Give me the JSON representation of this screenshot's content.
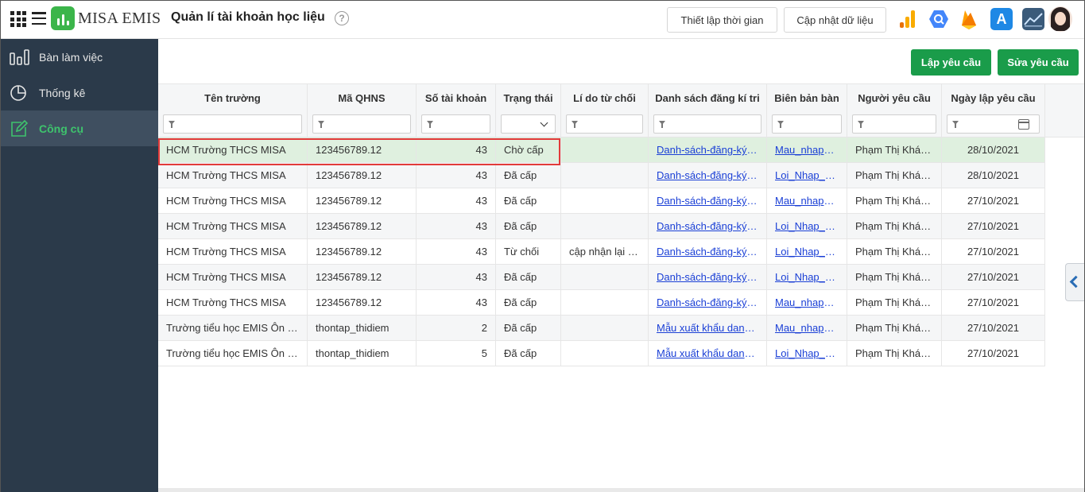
{
  "app": {
    "logo_text": "MISA EMIS",
    "page_title": "Quản lí tài khoản học liệu",
    "help_label": "?"
  },
  "toolbar": {
    "time_setup_label": "Thiết lập thời gian",
    "update_data_label": "Cập nhật dữ liệu",
    "store_icon_glyph": "A"
  },
  "sidebar": {
    "items": [
      {
        "label": "Bàn làm việc",
        "icon": "dashboard-icon",
        "active": false
      },
      {
        "label": "Thống kê",
        "icon": "pie-chart-icon",
        "active": false
      },
      {
        "label": "Công cụ",
        "icon": "edit-tool-icon",
        "active": true
      }
    ]
  },
  "actions": {
    "create_label": "Lập yêu cầu",
    "edit_label": "Sửa yêu cầu"
  },
  "table": {
    "columns": [
      "Tên trường",
      "Mã QHNS",
      "Số tài khoản",
      "Trạng thái",
      "Lí do từ chối",
      "Danh sách đăng kí tri",
      "Biên bản bàn",
      "Người yêu cầu",
      "Ngày lập yêu cầu"
    ],
    "rows": [
      {
        "school": "HCM Trường THCS MISA",
        "code": "123456789.12",
        "accounts": "43",
        "status": "Chờ cấp",
        "reason": "",
        "list": "Danh-sách-đăng-ký-tài-khoản",
        "minutes": "Mau_nhap_bien_ban",
        "requester": "Phạm Thị Khánh Linh",
        "date": "28/10/2021",
        "selected": true
      },
      {
        "school": "HCM Trường THCS MISA",
        "code": "123456789.12",
        "accounts": "43",
        "status": "Đã cấp",
        "reason": "",
        "list": "Danh-sách-đăng-ký-tài-khoản",
        "minutes": "Loi_Nhap_bien_ban",
        "requester": "Phạm Thị Khánh Linh",
        "date": "28/10/2021"
      },
      {
        "school": "HCM Trường THCS MISA",
        "code": "123456789.12",
        "accounts": "43",
        "status": "Đã cấp",
        "reason": "",
        "list": "Danh-sách-đăng-ký-tài-khoản",
        "minutes": "Mau_nhap_bien_ban",
        "requester": "Phạm Thị Khánh Linh",
        "date": "27/10/2021"
      },
      {
        "school": "HCM Trường THCS MISA",
        "code": "123456789.12",
        "accounts": "43",
        "status": "Đã cấp",
        "reason": "",
        "list": "Danh-sách-đăng-ký-tài-khoản",
        "minutes": "Loi_Nhap_bien_ban",
        "requester": "Phạm Thị Khánh Linh",
        "date": "27/10/2021"
      },
      {
        "school": "HCM Trường THCS MISA",
        "code": "123456789.12",
        "accounts": "43",
        "status": "Từ chối",
        "reason": "cập nhận lại thông tin",
        "list": "Danh-sách-đăng-ký-tài-khoản",
        "minutes": "Loi_Nhap_bien_ban",
        "requester": "Phạm Thị Khánh Linh",
        "date": "27/10/2021"
      },
      {
        "school": "HCM Trường THCS MISA",
        "code": "123456789.12",
        "accounts": "43",
        "status": "Đã cấp",
        "reason": "",
        "list": "Danh-sách-đăng-ký-tài-khoản",
        "minutes": "Loi_Nhap_bien_ban",
        "requester": "Phạm Thị Khánh Linh",
        "date": "27/10/2021"
      },
      {
        "school": "HCM Trường THCS MISA",
        "code": "123456789.12",
        "accounts": "43",
        "status": "Đã cấp",
        "reason": "",
        "list": "Danh-sách-đăng-ký-tài-khoản",
        "minutes": "Mau_nhap_bien_ban",
        "requester": "Phạm Thị Khánh Linh",
        "date": "27/10/2021"
      },
      {
        "school": "Trường tiểu học EMIS Ôn tập",
        "code": "thontap_thidiem",
        "accounts": "2",
        "status": "Đã cấp",
        "reason": "",
        "list": "Mẫu xuất khẩu danh sách",
        "minutes": "Mau_nhap_bien_ban",
        "requester": "Phạm Thị Khánh Linh",
        "date": "27/10/2021"
      },
      {
        "school": "Trường tiểu học EMIS Ôn tập",
        "code": "thontap_thidiem",
        "accounts": "5",
        "status": "Đã cấp",
        "reason": "",
        "list": "Mẫu xuất khẩu danh sách",
        "minutes": "Loi_Nhap_bien_ban",
        "requester": "Phạm Thị Khánh Linh",
        "date": "27/10/2021"
      }
    ]
  },
  "colors": {
    "sidebar_bg": "#2b3a4a",
    "active_green": "#3ec46d",
    "button_green": "#1a9c4a",
    "selected_row": "#dff0df",
    "link_blue": "#1a3fd6",
    "highlight_red": "#e23a3a"
  }
}
